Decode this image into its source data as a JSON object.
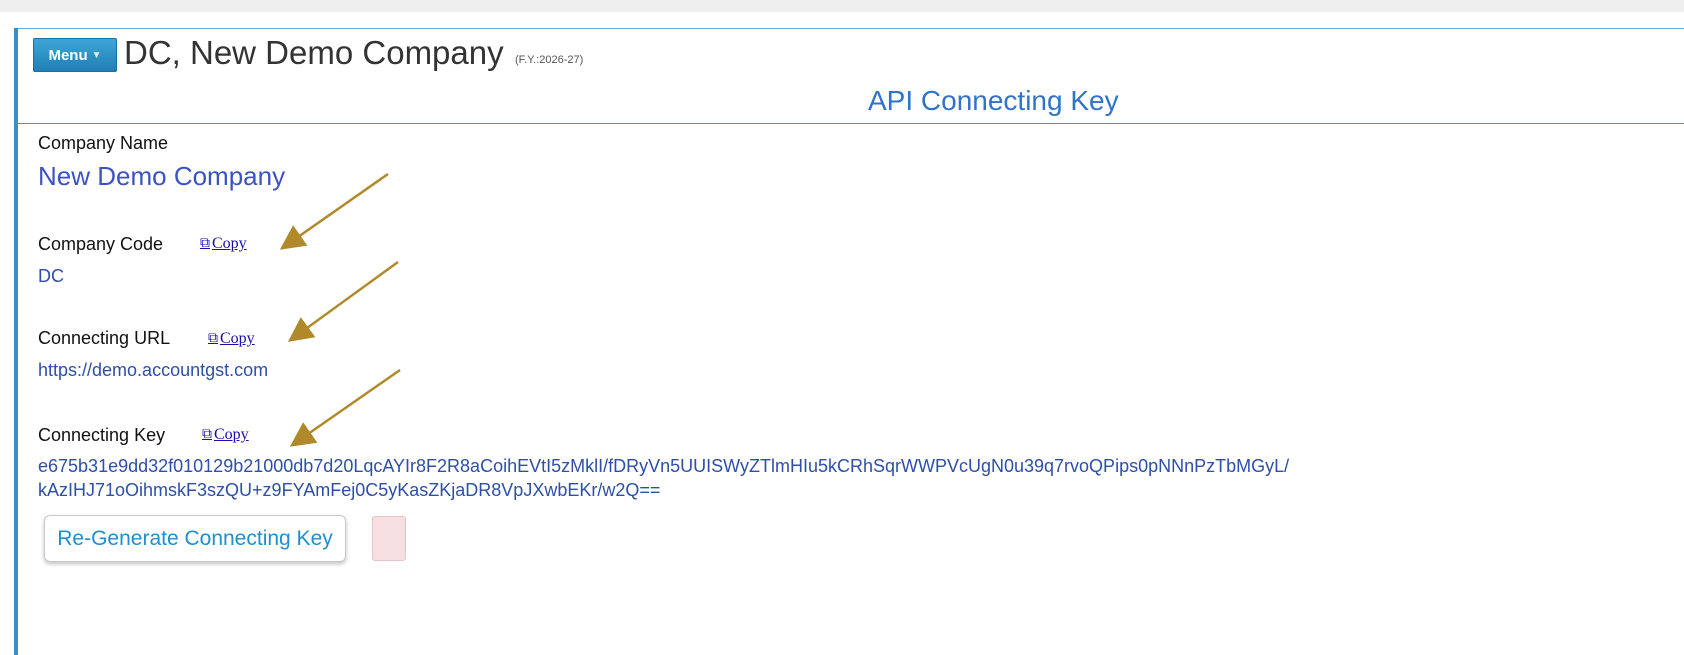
{
  "header": {
    "menu_label": "Menu",
    "company_title": "DC, New Demo Company",
    "fiscal_year": "(F.Y.:2026-27)"
  },
  "section": {
    "title": "API Connecting Key"
  },
  "company_name": {
    "label": "Company Name",
    "value": "New Demo Company"
  },
  "company_code": {
    "label": "Company Code",
    "copy_label": "Copy",
    "value": "DC"
  },
  "connecting_url": {
    "label": "Connecting URL",
    "copy_label": "Copy",
    "value": "https://demo.accountgst.com"
  },
  "connecting_key": {
    "label": "Connecting Key",
    "copy_label": "Copy",
    "value_line1": "e675b31e9dd32f010129b21000db7d20LqcAYIr8F2R8aCoihEVtI5zMklI/fDRyVn5UUISWyZTlmHIu5kCRhSqrWWPVcUgN0u39q7rvoQPips0pNNnPzTbMGyL/",
    "value_line2": "kAzIHJ71oOihmskF3szQU+z9FYAmFej0C5yKasZKjaDR8VpJXwbEKr/w2Q=="
  },
  "actions": {
    "regenerate_label": "Re-Generate Connecting Key"
  },
  "colors": {
    "accent": "#3b8fc2",
    "title_blue": "#2f74c9",
    "value_blue": "#2e4fa6",
    "link": "#1a0dab",
    "annotation_arrow": "#b08a2a",
    "status_box": "#f6dfe0"
  },
  "icons": {
    "menu_caret": "caret-down-icon",
    "copy": "copy-icon"
  }
}
